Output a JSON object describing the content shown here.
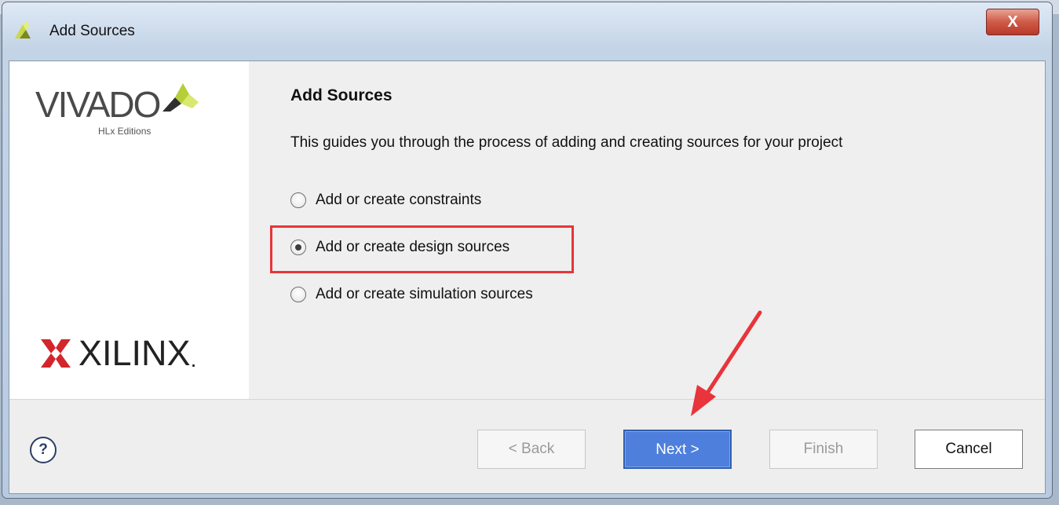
{
  "window": {
    "title": "Add Sources",
    "close_label": "X"
  },
  "left": {
    "vivado_text": "VIVADO",
    "edition_text": "HLx Editions",
    "xilinx_text": "XILINX",
    "xilinx_mark": "."
  },
  "main": {
    "heading": "Add Sources",
    "description": "This guides you through the process of adding and creating sources for your project",
    "options": [
      {
        "label": "Add or create constraints",
        "checked": false
      },
      {
        "label": "Add or create design sources",
        "checked": true
      },
      {
        "label": "Add or create simulation sources",
        "checked": false
      }
    ]
  },
  "footer": {
    "help_label": "?",
    "back_label": "< Back",
    "next_label": "Next >",
    "finish_label": "Finish",
    "cancel_label": "Cancel"
  },
  "colors": {
    "highlight": "#e8343a",
    "annotation_arrow": "#e8343a",
    "primary_button": "#4f7fdc",
    "vivado_accent": "#b5cf3a"
  }
}
